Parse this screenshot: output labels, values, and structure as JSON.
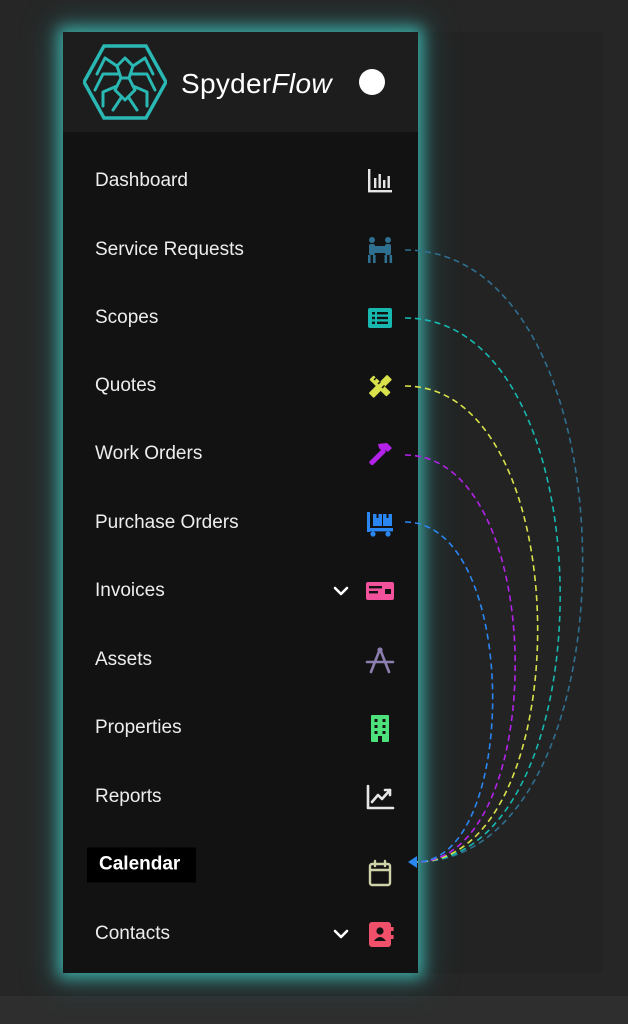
{
  "brand": {
    "name_part1": "Spyder",
    "name_part2": "Flow"
  },
  "menu": {
    "items": [
      {
        "label": "Dashboard",
        "icon": "bar-chart-icon",
        "color": "#e6e6e6"
      },
      {
        "label": "Service Requests",
        "icon": "people-carry-icon",
        "color": "#2f6f8f"
      },
      {
        "label": "Scopes",
        "icon": "list-alt-icon",
        "color": "#17b8b0"
      },
      {
        "label": "Quotes",
        "icon": "pencil-ruler-icon",
        "color": "#d9e24a"
      },
      {
        "label": "Work Orders",
        "icon": "hammer-icon",
        "color": "#b322e8"
      },
      {
        "label": "Purchase Orders",
        "icon": "dolly-boxes-icon",
        "color": "#2a86f0"
      },
      {
        "label": "Invoices",
        "icon": "money-check-icon",
        "color": "#f2519c",
        "has_submenu": true
      },
      {
        "label": "Assets",
        "icon": "drafting-compass-icon",
        "color": "#8c7fb0"
      },
      {
        "label": "Properties",
        "icon": "building-icon",
        "color": "#4ee07a"
      },
      {
        "label": "Reports",
        "icon": "chart-line-icon",
        "color": "#e6e6e6"
      },
      {
        "label": "Calendar",
        "icon": "calendar-icon",
        "color": "#cfd3a8",
        "active": true
      },
      {
        "label": "Contacts",
        "icon": "address-book-icon",
        "color": "#f0506a",
        "has_submenu": true
      }
    ]
  },
  "colors": {
    "accent_glow": "#40c4be",
    "sidebar_bg": "#121212",
    "header_bg": "#1d1d1d",
    "connector_arrow": "#2a86f0"
  }
}
